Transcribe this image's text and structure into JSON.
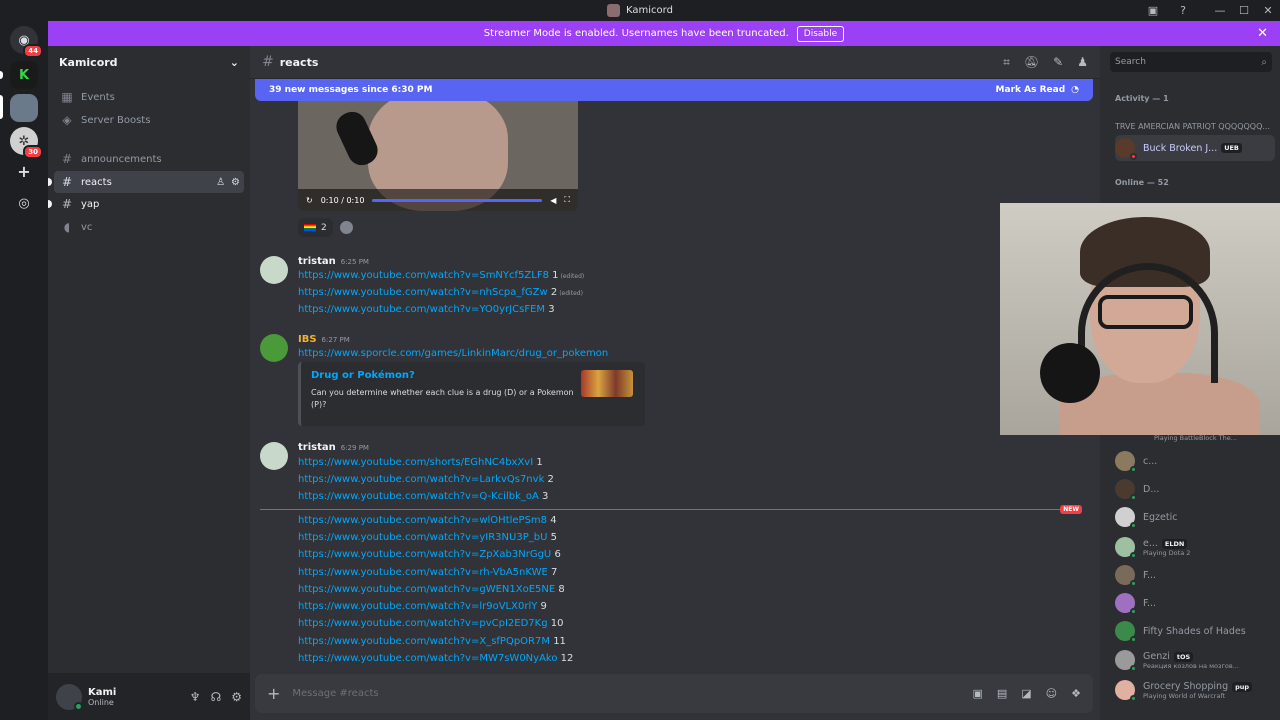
{
  "window": {
    "title": "Kamicord"
  },
  "banner": {
    "text": "Streamer Mode is enabled. Usernames have been truncated.",
    "disable_label": "Disable"
  },
  "guilds": {
    "badge_home": "44",
    "badge_server3": "30"
  },
  "sidebar": {
    "server_name": "Kamicord",
    "items": [
      {
        "label": "Events",
        "icon": "calendar-icon"
      },
      {
        "label": "Server Boosts",
        "icon": "boost-icon"
      },
      {
        "label": "announcements",
        "icon": "hash-icon"
      },
      {
        "label": "reacts",
        "icon": "hash-icon"
      },
      {
        "label": "yap",
        "icon": "hash-icon"
      },
      {
        "label": "vc",
        "icon": "speaker-icon"
      }
    ]
  },
  "user": {
    "name": "Kami",
    "status": "Online"
  },
  "chat": {
    "channel": "reacts",
    "new_messages": "39 new messages since 6:30 PM",
    "mark_read": "Mark As Read",
    "video_time": "0:10 / 0:10",
    "reaction_count": "2",
    "composer_placeholder": "Message #reacts",
    "new_label": "NEW",
    "edited": "(edited)"
  },
  "messages": [
    {
      "author": "tristan",
      "time": "6:25 PM",
      "lines": [
        {
          "url": "https://www.youtube.com/watch?v=SmNYcf5ZLF8",
          "n": "1",
          "edited": true
        },
        {
          "url": "https://www.youtube.com/watch?v=nhScpa_fGZw",
          "n": "2",
          "edited": true
        },
        {
          "url": "https://www.youtube.com/watch?v=YO0yrJCsFEM",
          "n": "3",
          "edited": false
        }
      ]
    },
    {
      "author": "IBS",
      "time": "6:27 PM",
      "url": "https://www.sporcle.com/games/LinkinMarc/drug_or_pokemon",
      "embed": {
        "title": "Drug or Pokémon?",
        "description": "Can you determine whether each clue is a drug (D) or a Pokemon (P)?"
      }
    },
    {
      "author": "tristan",
      "time": "6:29 PM",
      "lines": [
        {
          "url": "https://www.youtube.com/shorts/EGhNC4bxXvI",
          "n": "1"
        },
        {
          "url": "https://www.youtube.com/watch?v=LarkvQs7nvk",
          "n": "2"
        },
        {
          "url": "https://www.youtube.com/watch?v=Q-Kcilbk_oA",
          "n": "3"
        },
        {
          "url": "https://www.youtube.com/watch?v=wlOHtlePSm8",
          "n": "4"
        },
        {
          "url": "https://www.youtube.com/watch?v=yIR3NU3P_bU",
          "n": "5"
        },
        {
          "url": "https://www.youtube.com/watch?v=ZpXab3NrGgU",
          "n": "6"
        },
        {
          "url": "https://www.youtube.com/watch?v=rh-VbA5nKWE",
          "n": "7"
        },
        {
          "url": "https://www.youtube.com/watch?v=gWEN1XoE5NE",
          "n": "8"
        },
        {
          "url": "https://www.youtube.com/watch?v=lr9oVLX0rlY",
          "n": "9"
        },
        {
          "url": "https://www.youtube.com/watch?v=pvCpI2ED7Kg",
          "n": "10"
        },
        {
          "url": "https://www.youtube.com/watch?v=X_sfPQpOR7M",
          "n": "11"
        },
        {
          "url": "https://www.youtube.com/watch?v=MW7sW0NyAko",
          "n": "12"
        }
      ]
    }
  ],
  "members": {
    "search_placeholder": "Search",
    "activity_header": "Activity — 1",
    "activity_title": "TRVE AMERCIAN PATRIQT QQQQQQQ...",
    "activity_member": "Buck Broken J...",
    "activity_tag": "UEB",
    "online_header": "Online — 52",
    "partial_activity": "Playing BattleBlock The...",
    "list": [
      {
        "name": "c...",
        "sub": "",
        "tag": "",
        "color": "#8a7a60"
      },
      {
        "name": "D...",
        "sub": "",
        "tag": "",
        "color": "#4a3a30"
      },
      {
        "name": "Egzetic",
        "sub": "",
        "tag": "",
        "color": "#d0d0d0"
      },
      {
        "name": "e...",
        "sub": "Playing Dota 2",
        "tag": "ELDN",
        "color": "#9fc0a0"
      },
      {
        "name": "F...",
        "sub": "",
        "tag": "",
        "color": "#7a6a5a"
      },
      {
        "name": "F...",
        "sub": "",
        "tag": "",
        "color": "#a070c0"
      },
      {
        "name": "Fifty Shades of Hades",
        "sub": "",
        "tag": "",
        "color": "#3a8a4a"
      },
      {
        "name": "Genzi",
        "sub": "Реакция козлов на мозгов...",
        "tag": "tOS",
        "color": "#9a9a9a"
      },
      {
        "name": "Grocery Shopping",
        "sub": "Playing World of Warcraft",
        "tag": "pup",
        "color": "#e0b0a0"
      }
    ]
  }
}
